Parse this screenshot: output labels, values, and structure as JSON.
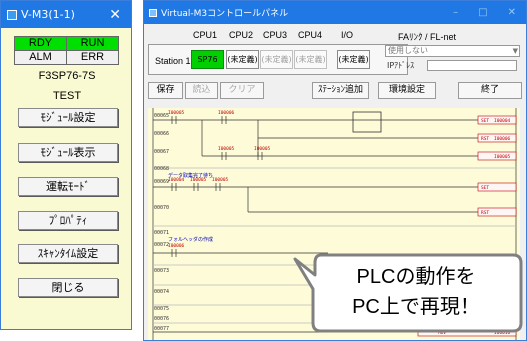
{
  "left_window": {
    "title": "V-M3(1-1)",
    "leds": [
      {
        "label": "RDY",
        "state": "on"
      },
      {
        "label": "RUN",
        "state": "on"
      },
      {
        "label": "ALM",
        "state": "off"
      },
      {
        "label": "ERR",
        "state": "off"
      }
    ],
    "model": "F3SP76-7S",
    "name": "TEST",
    "buttons": [
      "ﾓｼﾞｭｰﾙ設定",
      "ﾓｼﾞｭｰﾙ表示",
      "運転ﾓｰﾄﾞ",
      "ﾌﾟﾛﾊﾟﾃｨ",
      "ｽｷｬﾝﾀｲﾑ設定",
      "閉じる"
    ]
  },
  "main_window": {
    "title": "Virtual-M3コントロールパネル",
    "column_headers": [
      "CPU1",
      "CPU2",
      "CPU3",
      "CPU4",
      "I/O",
      "FAﾘﾝｸ / FL-net"
    ],
    "station_label": "Station 1",
    "slots": [
      {
        "label": "SP76",
        "state": "on"
      },
      {
        "label": "(未定義)",
        "state": "normal"
      },
      {
        "label": "(未定義)",
        "state": "dim"
      },
      {
        "label": "(未定義)",
        "state": "dim"
      },
      {
        "label": "(未定義)",
        "state": "normal"
      }
    ],
    "fa_select": "使用しない",
    "ip_label": "IPｱﾄﾞﾚｽ",
    "toolbar": {
      "save": "保存",
      "load": "読込",
      "clear": "クリア",
      "station_add": "ｽﾃｰｼｮﾝ追加",
      "env": "環境設定",
      "exit": "終了"
    }
  },
  "ladder": {
    "step_numbers": [
      "00065",
      "00066",
      "00067",
      "00068",
      "00069",
      "00070",
      "00071",
      "00072",
      "00073",
      "00074",
      "00075",
      "00076",
      "00077"
    ],
    "comments": [
      "データ取集完了待ち",
      "フォルヘッダの作成"
    ],
    "devices": [
      "I00005",
      "I00006",
      "I00005",
      "I00005",
      "I00004",
      "I00005",
      "I00005",
      "I00006",
      "I00004",
      "I00006",
      "I00005",
      "I00016"
    ],
    "instructions": [
      "SET",
      "RST",
      "SET",
      "RST",
      "MOV"
    ]
  },
  "callout": {
    "line1": "PLCの動作を",
    "line2": "PC上で再現！"
  }
}
